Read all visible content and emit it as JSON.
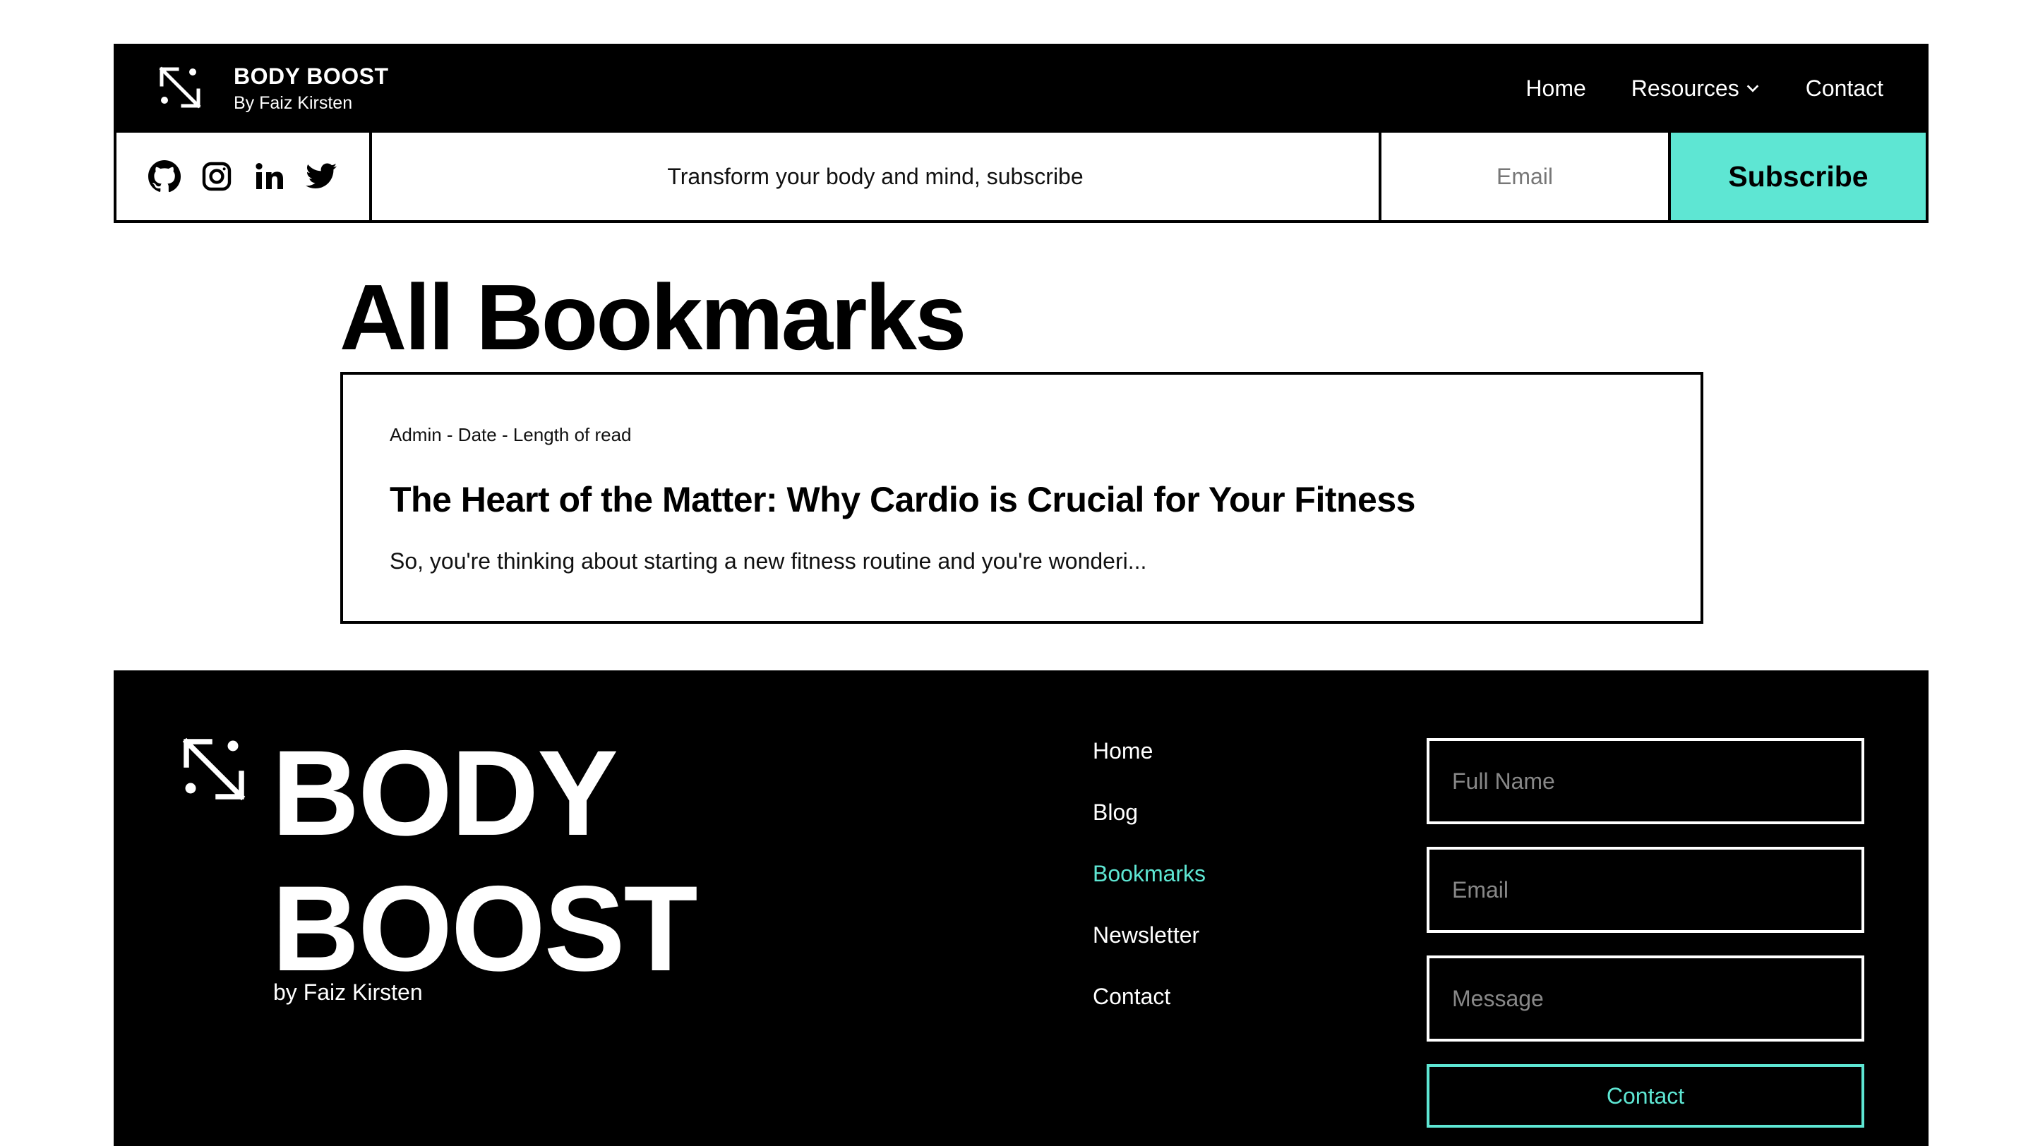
{
  "header": {
    "brand": {
      "title": "BODY BOOST",
      "subtitle": "By Faiz Kirsten"
    },
    "nav": [
      {
        "label": "Home"
      },
      {
        "label": "Resources"
      },
      {
        "label": "Contact"
      }
    ],
    "social_icons": [
      "github-icon",
      "instagram-icon",
      "linkedin-icon",
      "twitter-icon"
    ],
    "subscribe_bar": {
      "tagline": "Transform your body and mind, subscribe",
      "email_placeholder": "Email",
      "button_label": "Subscribe"
    }
  },
  "main": {
    "title": "All Bookmarks",
    "bookmarks": [
      {
        "meta": "Admin - Date - Length of read",
        "title": "The Heart of the Matter: Why Cardio is Crucial for Your Fitness",
        "excerpt": "So, you're thinking about starting a new fitness routine and you're wonderi..."
      }
    ]
  },
  "footer": {
    "brand_line1": "BODY",
    "brand_line2": "BOOST",
    "brand_sub": "by Faiz Kirsten",
    "links": [
      {
        "label": "Home",
        "active": false
      },
      {
        "label": "Blog",
        "active": false
      },
      {
        "label": "Bookmarks",
        "active": true
      },
      {
        "label": "Newsletter",
        "active": false
      },
      {
        "label": "Contact",
        "active": false
      }
    ],
    "form": {
      "name_placeholder": "Full Name",
      "email_placeholder": "Email",
      "message_placeholder": "Message",
      "button_label": "Contact"
    }
  },
  "colors": {
    "accent": "#5ee6d3",
    "primary": "#000000",
    "background": "#ffffff"
  }
}
